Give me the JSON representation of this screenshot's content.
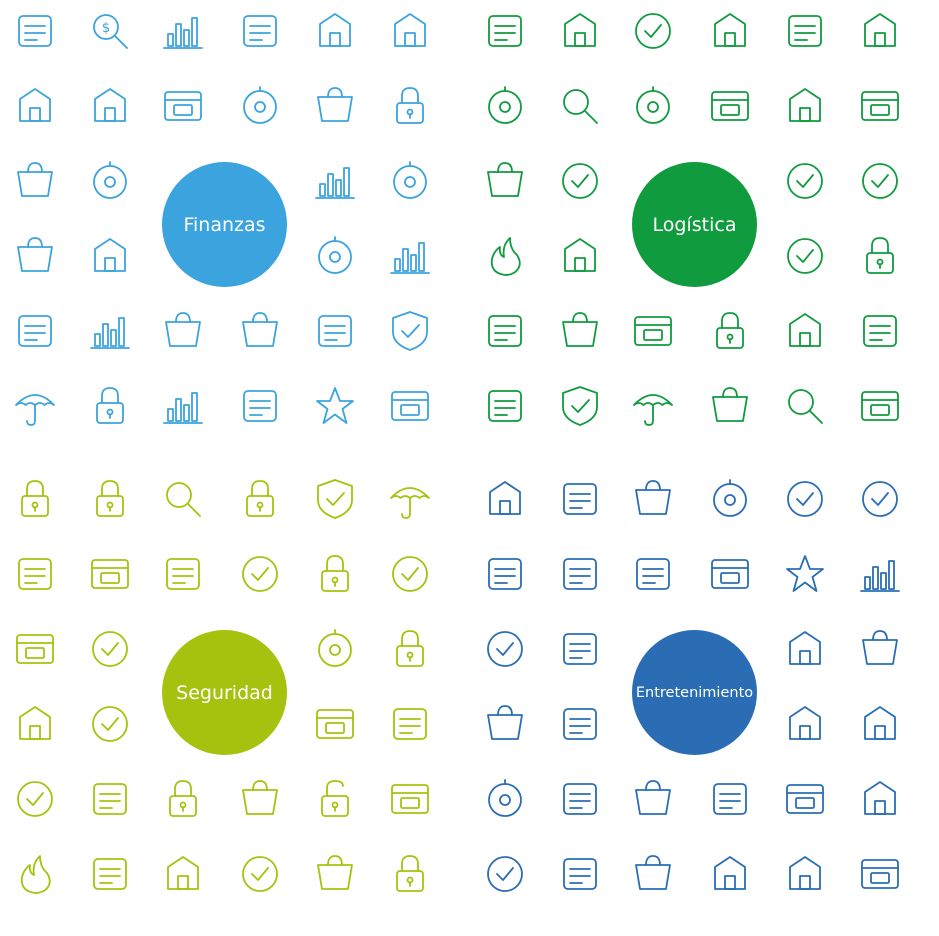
{
  "colors": {
    "finanzas": "#3ba3dd",
    "logistica": "#0f9b3e",
    "seguridad": "#a6c20e",
    "entretenimiento": "#2a6db5"
  },
  "sections": [
    {
      "id": "finanzas",
      "label": "Finanzas",
      "color": "#3ba3dd",
      "icons": [
        "banknote-icon",
        "money-search-icon",
        "bar-chart-icon",
        "businessman-icon",
        "bank-building-icon",
        "piggy-bank-icon",
        "balance-scale-icon",
        "wallet-icon",
        "atm-card-icon",
        "coin-stack-icon",
        "handshake-icon",
        "locked-card-icon",
        "gavel-icon",
        "hand-coin-icon",
        "",
        "",
        "falling-chart-icon",
        "stopwatch-coin-icon",
        "currency-exchange-icon",
        "cash-register-icon",
        "",
        "",
        "coin-purse-icon",
        "rising-chart-icon",
        "calculator-icon",
        "pie-chart-icon",
        "document-pen-icon",
        "money-bag-icon",
        "atm-cash-icon",
        "shield-check-icon",
        "umbrella-icon",
        "mobile-lock-icon",
        "gold-bars-icon",
        "briefcase-icon",
        "diamond-icon",
        "safe-icon"
      ]
    },
    {
      "id": "logistica",
      "label": "Logística",
      "color": "#0f9b3e",
      "icons": [
        "airplane-icon",
        "globe-pin-icon",
        "online-shop-icon",
        "hand-truck-icon",
        "clipboard-icon",
        "courier-icon",
        "stopwatch-icon",
        "globe-search-icon",
        "compass-icon",
        "container-icon",
        "cargo-ship-icon",
        "calendar-icon",
        "truck-icon",
        "envelope-icon",
        "",
        "",
        "map-pin-icon",
        "train-icon",
        "fire-icon",
        "weight-kg-icon",
        "",
        "",
        "support-24-icon",
        "box-clock-icon",
        "scale-icon",
        "fragile-glass-icon",
        "return-box-icon",
        "clock-icon",
        "forklift-icon",
        "headset-icon",
        "this-side-up-icon",
        "box-shield-icon",
        "umbrella-icon",
        "warehouse-icon",
        "box-search-icon",
        "hand-box-icon"
      ]
    },
    {
      "id": "seguridad",
      "label": "Seguridad",
      "color": "#a6c20e",
      "icons": [
        "home-lock-icon",
        "pattern-lock-icon",
        "magnifier-icon",
        "browser-lock-icon",
        "shield-check-icon",
        "umbrella-icon",
        "security-camera-icon",
        "firewall-icon",
        "chain-link-icon",
        "fingerprint-icon",
        "card-lock-icon",
        "warning-icon",
        "id-card-icon",
        "bug-icon",
        "",
        "",
        "lifebuoy-icon",
        "mobile-lock-icon",
        "eye-icon",
        "megaphone-icon",
        "",
        "",
        "server-icon",
        "alarm-light-icon",
        "keypad-icon",
        "bomb-icon",
        "cloud-lock-icon",
        "tools-icon",
        "unlocked-padlock-icon",
        "safe-icon",
        "fire-icon",
        "stop-hand-icon",
        "skull-icon",
        "password-field-icon",
        "key-icon",
        "padlock-icon"
      ]
    },
    {
      "id": "entretenimiento",
      "label": "Entretenimiento",
      "color": "#2a6db5",
      "icons": [
        "clapperboard-icon",
        "movie-camera-icon",
        "film-strip-icon",
        "film-reel-icon",
        "director-chair-icon",
        "megaphone-icon",
        "3d-glasses-icon",
        "soda-cup-icon",
        "microphone-icon",
        "cinema-screen-icon",
        "star-icon",
        "rope-barrier-icon",
        "spotlight-icon",
        "theater-stage-icon",
        "",
        "",
        "popcorn-icon",
        "tickets-icon",
        "theater-masks-icon",
        "museum-icon",
        "",
        "",
        "quill-icon",
        "piano-icon",
        "vinyl-icon",
        "gramophone-icon",
        "speaker-icon",
        "mixer-sliders-icon",
        "hd-monitor-icon",
        "headphones-icon",
        "trophy-icon",
        "easel-icon",
        "palette-icon",
        "camera-icon",
        "music-notes-icon",
        "retro-tv-icon"
      ]
    }
  ]
}
